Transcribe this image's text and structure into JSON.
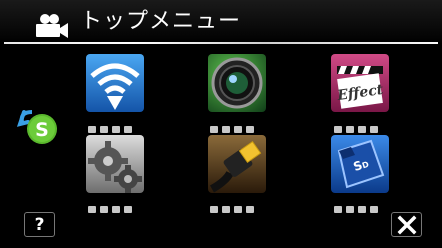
{
  "header": {
    "title": "トップメニュー",
    "mode_icon": "movie-camera-icon"
  },
  "side": {
    "icon": "swap-s-icon"
  },
  "tiles": [
    {
      "icon": "wifi-icon",
      "accent": "#1d6fc4"
    },
    {
      "icon": "lens-icon",
      "accent": "#2e8a3c"
    },
    {
      "icon": "effect-clapper-icon",
      "accent": "#b3306a"
    },
    {
      "icon": "gear-icon",
      "accent": "#8d8d8d"
    },
    {
      "icon": "hdmi-cable-icon",
      "accent": "#6b4a2a"
    },
    {
      "icon": "sd-card-icon",
      "accent": "#1f5fc0"
    }
  ],
  "buttons": {
    "help_label": "?",
    "close_icon": "close-icon"
  },
  "tile3_text": "Effect",
  "sd_text": "S",
  "sd_sub": "D"
}
